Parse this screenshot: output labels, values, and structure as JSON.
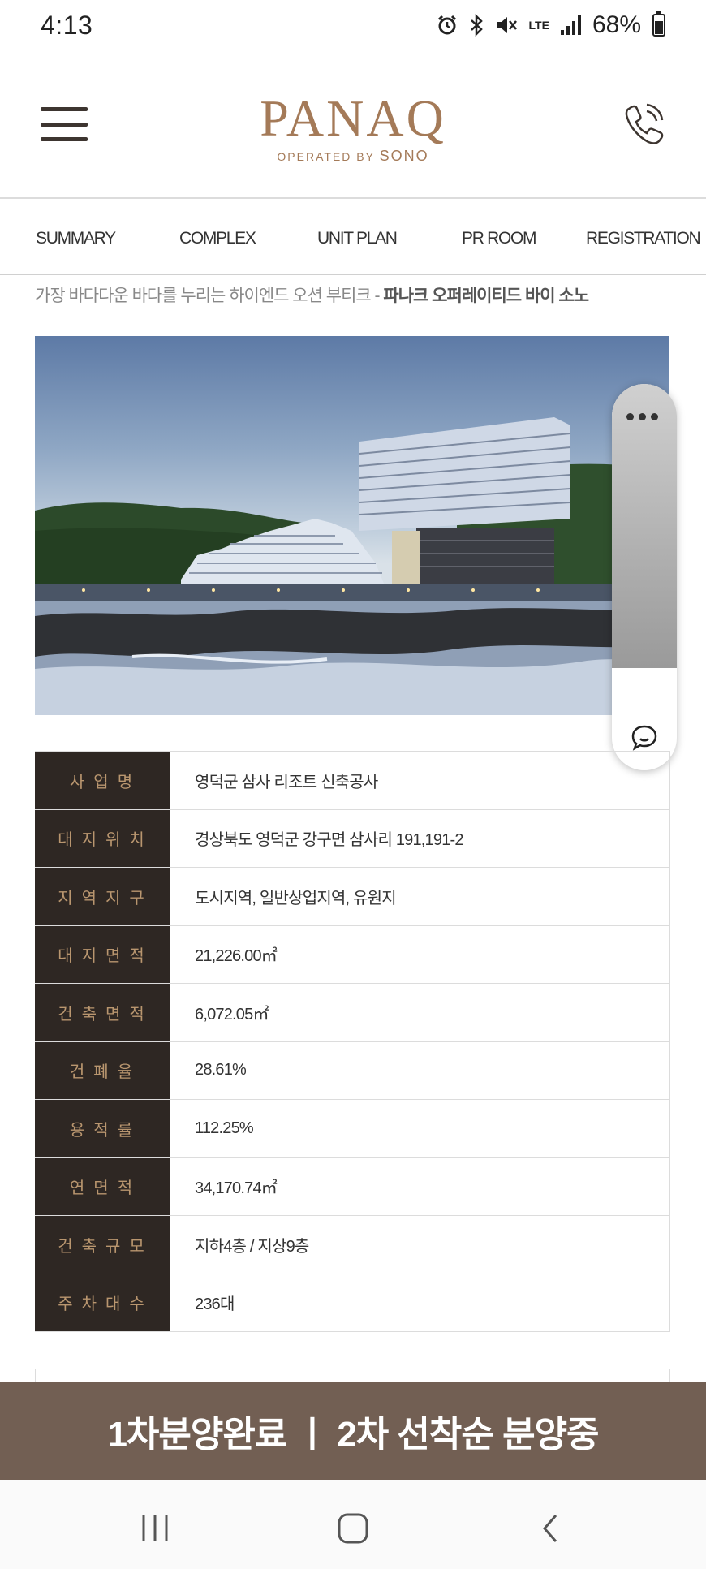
{
  "status_bar": {
    "time": "4:13",
    "battery": "68%",
    "battery_level": 0.68,
    "network": "LTE"
  },
  "header": {
    "logo_main": "PANAQ",
    "logo_sub": "OPERATED BY",
    "logo_sub_brand": "SONO"
  },
  "nav": {
    "items": [
      {
        "label": "SUMMARY"
      },
      {
        "label": "COMPLEX"
      },
      {
        "label": "UNIT PLAN"
      },
      {
        "label": "PR ROOM"
      },
      {
        "label": "REGISTRATION"
      }
    ]
  },
  "tagline": {
    "text": "가장 바다다운 바다를 누리는 하이엔드 오션 부티크 - ",
    "bold": "파나크 오퍼레이티드 바이 소노"
  },
  "info_table": {
    "rows": [
      {
        "label": "사업명",
        "value": "영덕군 삼사 리조트 신축공사"
      },
      {
        "label": "대지위치",
        "value": "경상북도 영덕군 강구면 삼사리 191,191-2"
      },
      {
        "label": "지역지구",
        "value": "도시지역, 일반상업지역, 유원지"
      },
      {
        "label": "대지면적",
        "value": "21,226.00㎡"
      },
      {
        "label": "건축면적",
        "value": "6,072.05㎡"
      },
      {
        "label": "건폐율",
        "value": "28.61%"
      },
      {
        "label": "용적률",
        "value": "112.25%"
      },
      {
        "label": "연면적",
        "value": "34,170.74㎡"
      },
      {
        "label": "건축규모",
        "value": "지하4층 / 지상9층"
      },
      {
        "label": "주차대수",
        "value": "236대"
      }
    ]
  },
  "banner": {
    "text": "1차분양완료 ㅣ 2차 선착순 분양중"
  },
  "colors": {
    "brand": "#a47a58",
    "table_label_bg": "#2e2723",
    "table_label_text": "#b9966f",
    "banner_bg": "#725f53"
  }
}
